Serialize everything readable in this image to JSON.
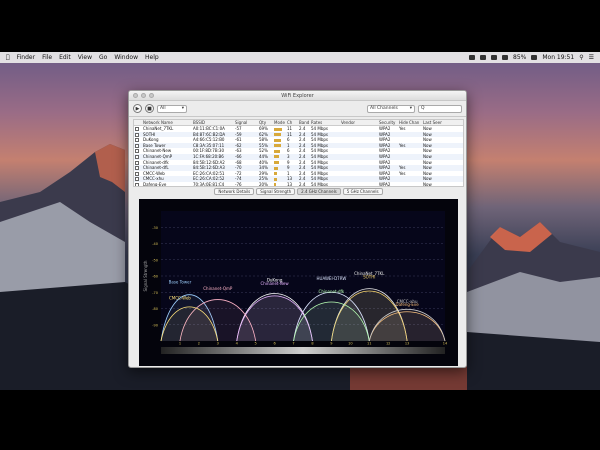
{
  "menubar": {
    "items": [
      "",
      "Finder",
      "File",
      "Edit",
      "View",
      "Go",
      "Window",
      "Help"
    ],
    "battery": "85%",
    "clock": "Mon 19:51"
  },
  "window": {
    "title": "WiFi Explorer",
    "filter_select": "All",
    "search_select": "All Channels",
    "search_placeholder": "Q"
  },
  "table": {
    "headers": [
      "",
      "Network Name",
      "BSSID",
      "Signal",
      "Qty",
      "Mode",
      "Ch",
      "Band",
      "Rates",
      "Vendor",
      "Security",
      "Hide",
      "Chan",
      "Last Seen"
    ],
    "rows": [
      {
        "name": "ChinaNet_7TKL",
        "bssid": "A0:11:BC:C1:0A",
        "signal": "-57",
        "qty": "69%",
        "ch": "11",
        "band": "2.4",
        "rates": "54 Mbps",
        "vendor": "",
        "security": "WPA2",
        "hide": "Yes",
        "last": "Now",
        "bar": 0.7
      },
      {
        "name": "SOTHI",
        "bssid": "B4:87:6C:B2:DA",
        "signal": "-59",
        "qty": "62%",
        "ch": "11",
        "band": "2.4",
        "rates": "54 Mbps",
        "vendor": "",
        "security": "WPA2",
        "hide": "",
        "last": "Now",
        "bar": 0.62
      },
      {
        "name": "DuKong",
        "bssid": "A4:66:C5:12:B0",
        "signal": "-61",
        "qty": "58%",
        "ch": "6",
        "band": "2.4",
        "rates": "54 Mbps",
        "vendor": "",
        "security": "WPA2",
        "hide": "",
        "last": "Now",
        "bar": 0.58
      },
      {
        "name": "Base Tower",
        "bssid": "C8:3A:35:07:11",
        "signal": "-62",
        "qty": "55%",
        "ch": "1",
        "band": "2.4",
        "rates": "54 Mbps",
        "vendor": "",
        "security": "WPA2",
        "hide": "Yes",
        "last": "Now",
        "bar": 0.55
      },
      {
        "name": "Chinanet-New",
        "bssid": "00:1F:8D:7B:30",
        "signal": "-63",
        "qty": "52%",
        "ch": "6",
        "band": "2.4",
        "rates": "54 Mbps",
        "vendor": "",
        "security": "WPA2",
        "hide": "",
        "last": "Now",
        "bar": 0.52
      },
      {
        "name": "Chinanet-QmP",
        "bssid": "1C:FA:68:20:B6",
        "signal": "-66",
        "qty": "44%",
        "ch": "3",
        "band": "2.4",
        "rates": "54 Mbps",
        "vendor": "",
        "security": "WPA2",
        "hide": "",
        "last": "Now",
        "bar": 0.44
      },
      {
        "name": "Chinanet-dfk",
        "bssid": "84:5B:12:6D:A2",
        "signal": "-68",
        "qty": "40%",
        "ch": "9",
        "band": "2.4",
        "rates": "54 Mbps",
        "vendor": "",
        "security": "WPA2",
        "hide": "",
        "last": "Now",
        "bar": 0.4
      },
      {
        "name": "Chinanet-dfL",
        "bssid": "84:5B:12:6D:A3",
        "signal": "-70",
        "qty": "34%",
        "ch": "9",
        "band": "2.4",
        "rates": "54 Mbps",
        "vendor": "",
        "security": "WPA2",
        "hide": "Yes",
        "last": "Now",
        "bar": 0.34
      },
      {
        "name": "CMCC-Web",
        "bssid": "EC:26:CA:02:51",
        "signal": "-72",
        "qty": "29%",
        "ch": "1",
        "band": "2.4",
        "rates": "54 Mbps",
        "vendor": "",
        "security": "WPA2",
        "hide": "Yes",
        "last": "Now",
        "bar": 0.29
      },
      {
        "name": "CMCC-xhu",
        "bssid": "EC:26:CA:02:52",
        "signal": "-74",
        "qty": "25%",
        "ch": "13",
        "band": "2.4",
        "rates": "54 Mbps",
        "vendor": "",
        "security": "WPA2",
        "hide": "",
        "last": "Now",
        "bar": 0.25
      },
      {
        "name": "Dafeng-Eve",
        "bssid": "70:3A:0E:81:C4",
        "signal": "-76",
        "qty": "20%",
        "ch": "13",
        "band": "2.4",
        "rates": "54 Mbps",
        "vendor": "",
        "security": "WPA2",
        "hide": "",
        "last": "Now",
        "bar": 0.2
      }
    ]
  },
  "tabs": [
    "Network Details",
    "Signal Strength",
    "2.4 GHz Channels",
    "5 GHz Channels"
  ],
  "chart_data": {
    "type": "area",
    "xlabel": "",
    "ylabel": "Signal Strength",
    "x_ticks": [
      "",
      "1",
      "2",
      "3",
      "4",
      "5",
      "6",
      "7",
      "8",
      "9",
      "10",
      "11",
      "12",
      "13",
      "",
      "14"
    ],
    "y_ticks": [
      "-30",
      "-40",
      "-50",
      "-60",
      "-70",
      "-80",
      "-90"
    ],
    "ylim": [
      -100,
      -20
    ],
    "networks": [
      {
        "name": "ChinaNet_7TKL",
        "channel": 11,
        "signal": -57,
        "color": "#e8e8e8"
      },
      {
        "name": "SOTHI",
        "channel": 11,
        "signal": -59,
        "color": "#f5d36b"
      },
      {
        "name": "DuKong",
        "channel": 6,
        "signal": -61,
        "color": "#ffffff"
      },
      {
        "name": "HUAWEI-D7RW",
        "channel": 9,
        "signal": -60,
        "color": "#dde6ff"
      },
      {
        "name": "Base Tower",
        "channel": 1,
        "signal": -62,
        "color": "#9ed0ff"
      },
      {
        "name": "Chinanet-New",
        "channel": 6,
        "signal": -63,
        "color": "#e6b3ff"
      },
      {
        "name": "Chinanet-QmP",
        "channel": 3,
        "signal": -66,
        "color": "#ffb4c8"
      },
      {
        "name": "Chinanet-dfk",
        "channel": 9,
        "signal": -68,
        "color": "#b7ffb3"
      },
      {
        "name": "CMCC-Web",
        "channel": 1,
        "signal": -72,
        "color": "#ffe27a"
      },
      {
        "name": "Dafeng-Eve",
        "channel": 13,
        "signal": -76,
        "color": "#ffc27a"
      },
      {
        "name": "CMCC-xhu",
        "channel": 13,
        "signal": -74,
        "color": "#c9c9c9"
      }
    ]
  }
}
